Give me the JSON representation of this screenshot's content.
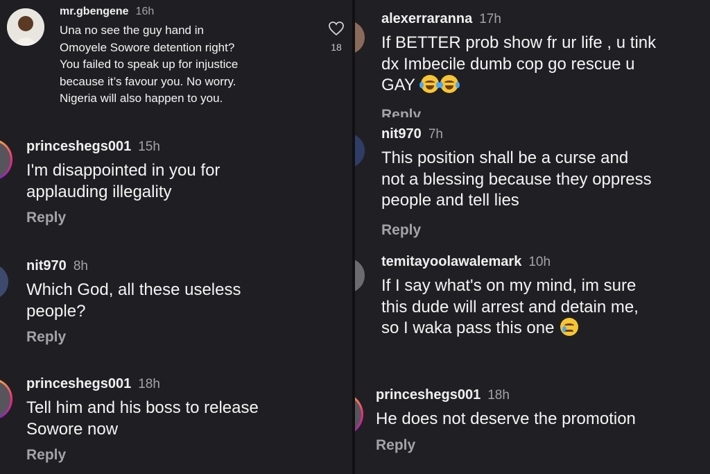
{
  "left": {
    "top_comment": {
      "username": "mr.gbengene",
      "time": "16h",
      "lines": [
        "Una no see the guy hand  in",
        "Omoyele Sowore detention right?",
        "You failed to speak up for injustice",
        "because it’s favour you.  No worry.",
        "Nigeria will also happen to you."
      ]
    },
    "comments": [
      {
        "username": "princeshegs001",
        "time": "15h",
        "lines": [
          "I'm disappointed in you for",
          "applauding illegality"
        ],
        "reply": "Reply"
      },
      {
        "username": "nit970",
        "time": "8h",
        "lines": [
          "Which God, all these useless",
          "people?"
        ],
        "reply": "Reply"
      },
      {
        "username": "princeshegs001",
        "time": "18h",
        "lines": [
          "Tell him and his boss to release",
          "Sowore now"
        ],
        "reply": "Reply"
      }
    ]
  },
  "right": {
    "like_count": "18",
    "comments": [
      {
        "username": "alexerraranna",
        "time": "17h",
        "lines": [
          "If BETTER prob show fr ur life , u tink",
          "dx Imbecile dumb cop go rescue u",
          "GAY"
        ],
        "reply": "Reply"
      },
      {
        "username": "nit970",
        "time": "7h",
        "lines": [
          "This position shall be a curse and",
          "not a blessing because they oppress",
          "people and tell lies"
        ],
        "reply": "Reply"
      },
      {
        "username": "temitayoolawalemark",
        "time": "10h",
        "lines": [
          "If I say what's on my mind, im sure",
          "this dude will arrest and detain me,",
          "so I waka pass this one"
        ]
      },
      {
        "username": "princeshegs001",
        "time": "18h",
        "lines": [
          "He does not deserve the promotion"
        ],
        "reply": "Reply"
      }
    ]
  },
  "icons": {
    "like": "heart-icon",
    "laugh_emoji": "face-with-tears-of-joy-emoji",
    "cry_emoji": "crying-face-emoji"
  }
}
